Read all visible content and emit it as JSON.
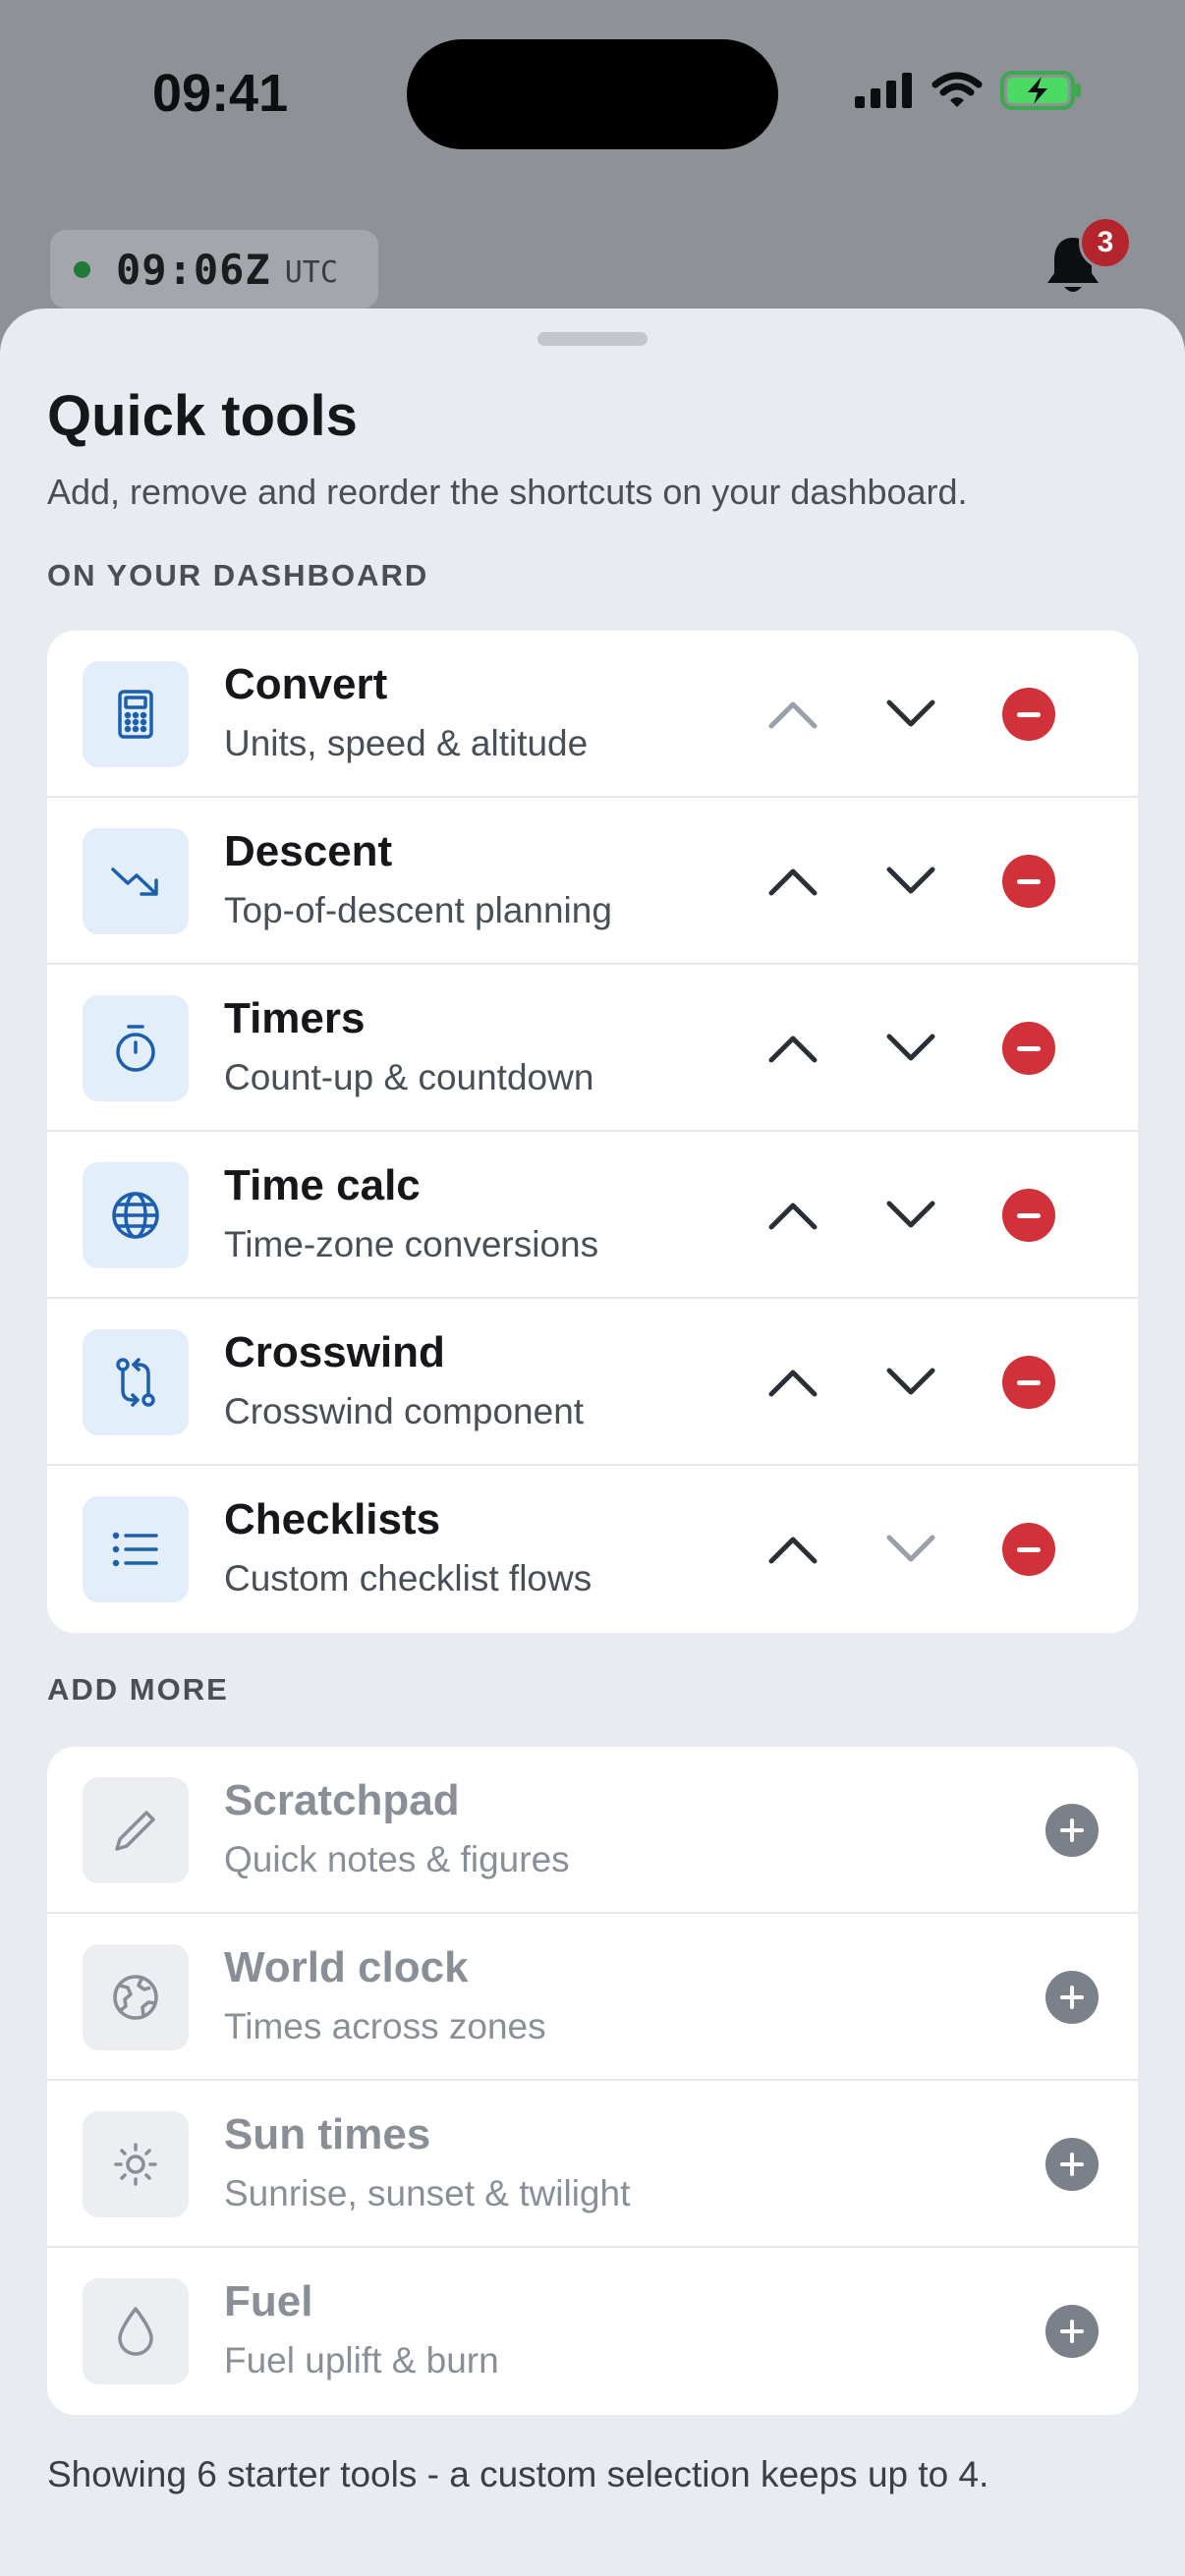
{
  "status_bar": {
    "time": "09:41",
    "icons": [
      "signal-icon",
      "wifi-icon",
      "battery-charging-icon"
    ]
  },
  "header": {
    "utc_time": "09:06Z",
    "utc_label": "UTC",
    "notification_count": "3"
  },
  "sheet": {
    "title": "Quick tools",
    "subtitle": "Add, remove and reorder the shortcuts on your dashboard.",
    "dashboard_section_label": "ON YOUR DASHBOARD",
    "add_more_section_label": "ADD MORE",
    "dashboard_tools": [
      {
        "title": "Convert",
        "description": "Units, speed & altitude",
        "icon": "calculator-icon",
        "can_move_up": false,
        "can_move_down": true
      },
      {
        "title": "Descent",
        "description": "Top-of-descent planning",
        "icon": "trending-down-icon",
        "can_move_up": true,
        "can_move_down": true
      },
      {
        "title": "Timers",
        "description": "Count-up & countdown",
        "icon": "stopwatch-icon",
        "can_move_up": true,
        "can_move_down": true
      },
      {
        "title": "Time calc",
        "description": "Time-zone conversions",
        "icon": "globe-icon",
        "can_move_up": true,
        "can_move_down": true
      },
      {
        "title": "Crosswind",
        "description": "Crosswind component",
        "icon": "swap-arrows-icon",
        "can_move_up": true,
        "can_move_down": true
      },
      {
        "title": "Checklists",
        "description": "Custom checklist flows",
        "icon": "list-icon",
        "can_move_up": true,
        "can_move_down": false
      }
    ],
    "available_tools": [
      {
        "title": "Scratchpad",
        "description": "Quick notes & figures",
        "icon": "pencil-icon"
      },
      {
        "title": "World clock",
        "description": "Times across zones",
        "icon": "earth-icon"
      },
      {
        "title": "Sun times",
        "description": "Sunrise, sunset & twilight",
        "icon": "sun-icon"
      },
      {
        "title": "Fuel",
        "description": "Fuel uplift & burn",
        "icon": "droplet-icon"
      }
    ],
    "footer_note": "Showing 6 starter tools - a custom selection keeps up to 4."
  },
  "colors": {
    "accent_blue": "#1d5fad",
    "remove_red": "#d13139",
    "add_gray": "#7b8089",
    "badge_red": "#b4242c",
    "battery_green": "#4cd964"
  }
}
